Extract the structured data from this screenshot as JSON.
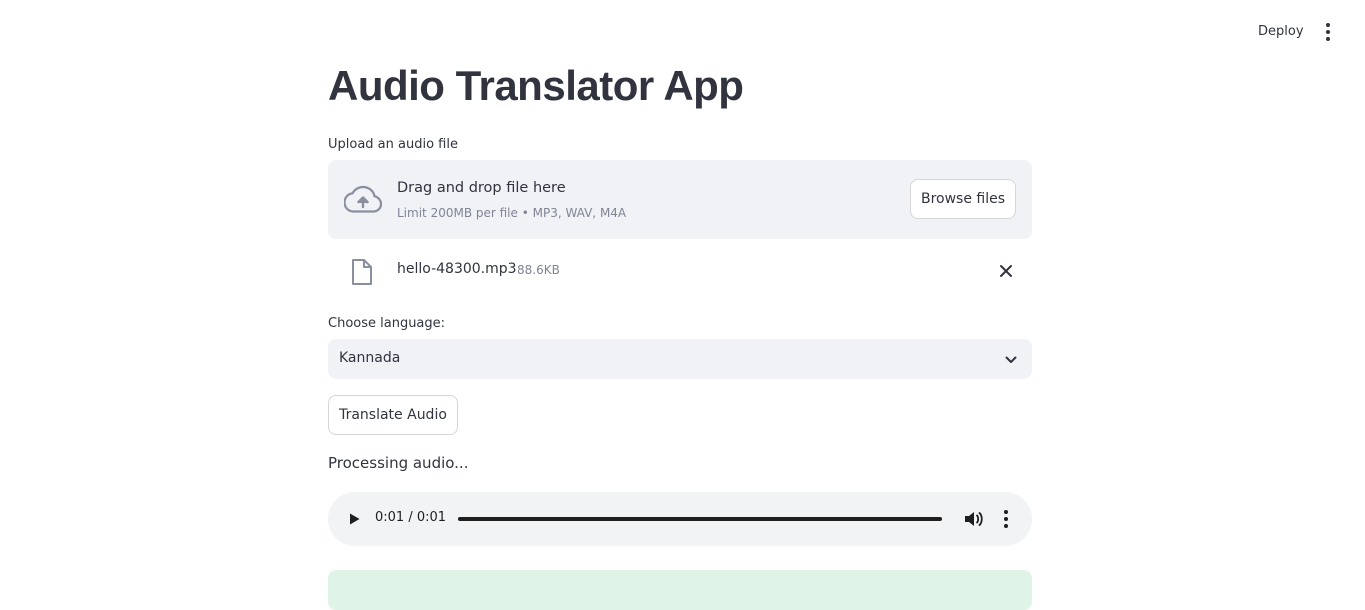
{
  "header": {
    "deploy_label": "Deploy",
    "menu_icon": "kebab-menu-icon"
  },
  "page": {
    "title": "Audio Translator App"
  },
  "uploader": {
    "label": "Upload an audio file",
    "drop_title": "Drag and drop file here",
    "drop_subtitle": "Limit 200MB per file • MP3, WAV, M4A",
    "browse_label": "Browse files",
    "icon": "cloud-upload-icon"
  },
  "uploaded_file": {
    "name": "hello-48300.mp3",
    "size": "88.6KB",
    "icon": "file-icon",
    "remove_icon": "close-icon"
  },
  "language": {
    "label": "Choose language:",
    "selected": "Kannada"
  },
  "actions": {
    "translate_label": "Translate Audio"
  },
  "status": {
    "text": "Processing audio..."
  },
  "audio_player": {
    "time": "0:01 / 0:01",
    "progress": 1.0
  },
  "colors": {
    "text": "#31333f",
    "muted": "#808495",
    "panel": "#f0f2f6",
    "success_bg": "#dff4e6"
  }
}
